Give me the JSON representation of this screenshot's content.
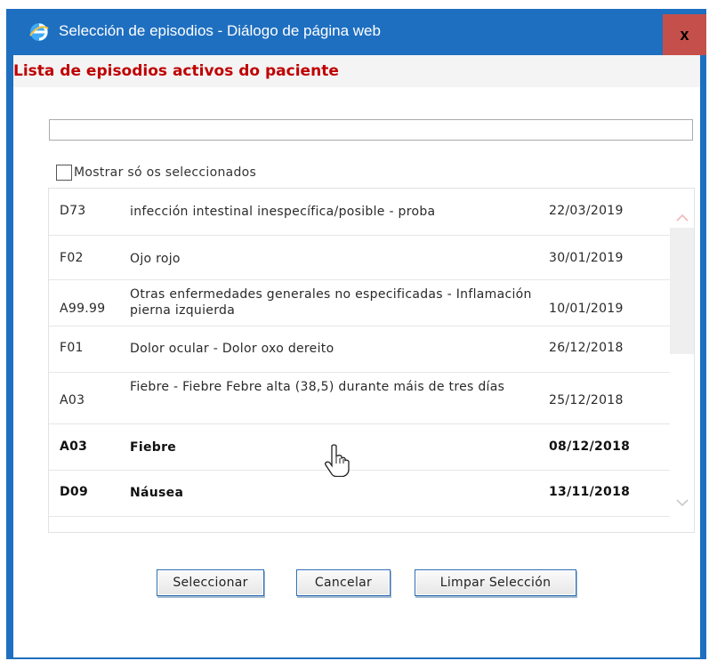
{
  "window": {
    "title": "Selección de episodios - Diálogo de página web",
    "close_label": "x",
    "icons": {
      "app": "ie-icon",
      "close": "close-icon"
    }
  },
  "heading": "Lista de episodios activos do paciente",
  "search": {
    "value": "",
    "placeholder": ""
  },
  "filter": {
    "label": "Mostrar só os seleccionados",
    "checked": false
  },
  "episodes": [
    {
      "code": "D73",
      "description": "infección intestinal inespecífica/posible - proba",
      "date": "22/03/2019",
      "bold": false
    },
    {
      "code": "F02",
      "description": "Ojo rojo",
      "date": "30/01/2019",
      "bold": false
    },
    {
      "code": "A99.99",
      "description": "Otras enfermedades generales no especificadas - Inflamación pierna izquierda",
      "date": "10/01/2019",
      "bold": false
    },
    {
      "code": "F01",
      "description": "Dolor ocular - Dolor oxo dereito",
      "date": "26/12/2018",
      "bold": false
    },
    {
      "code": "A03",
      "description": "Fiebre - Fiebre Febre alta (38,5) durante máis de tres días",
      "date": "25/12/2018",
      "bold": false
    },
    {
      "code": "A03",
      "description": "Fiebre",
      "date": "08/12/2018",
      "bold": true
    },
    {
      "code": "D09",
      "description": "Náusea",
      "date": "13/11/2018",
      "bold": true
    }
  ],
  "buttons": {
    "select": "Seleccionar",
    "cancel": "Cancelar",
    "clear": "Limpar Selección"
  },
  "colors": {
    "titlebar": "#1e6fc0",
    "close": "#c5504b",
    "heading_text": "#c00000",
    "button_border": "#2e6fb5"
  }
}
